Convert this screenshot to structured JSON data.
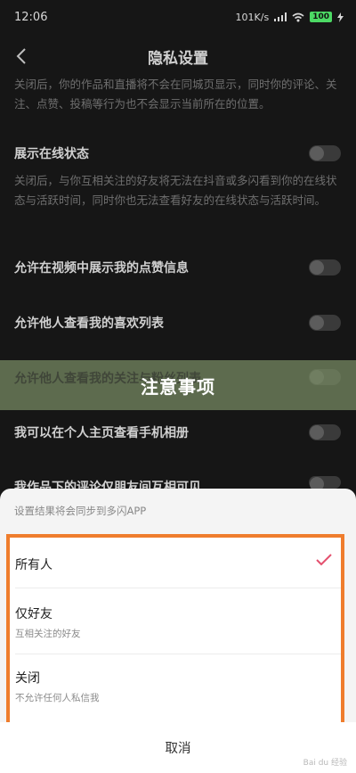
{
  "status_bar": {
    "time": "12:06",
    "network_speed": "101K/s",
    "battery": "100"
  },
  "nav": {
    "title": "隐私设置"
  },
  "top_desc": "关闭后，你的作品和直播将不会在同城页显示，同时你的评论、关注、点赞、投稿等行为也不会显示当前所在的位置。",
  "settings": [
    {
      "title": "展示在线状态",
      "desc": "关闭后，与你互相关注的好友将无法在抖音或多闪看到你的在线状态与活跃时间，同时你也无法查看好友的在线状态与活跃时间。"
    },
    {
      "title": "允许在视频中展示我的点赞信息"
    },
    {
      "title": "允许他人查看我的喜欢列表"
    },
    {
      "title": "允许他人查看我的关注与粉丝列表"
    },
    {
      "title": "我可以在个人主页查看手机相册"
    },
    {
      "title": "我作品下的评论仅朋友间互相可见"
    }
  ],
  "banner": {
    "title": "注意事项",
    "ghost": "允许他人查看我的关注与粉丝列表"
  },
  "sheet": {
    "hint": "设置结果将会同步到多闪APP",
    "options": [
      {
        "label": "所有人",
        "sub": "",
        "selected": true
      },
      {
        "label": "仅好友",
        "sub": "互相关注的好友",
        "selected": false
      },
      {
        "label": "关闭",
        "sub": "不允许任何人私信我",
        "selected": false
      }
    ],
    "cancel": "取消",
    "accent_color": "#ef7d2d",
    "check_color": "#e4506e"
  },
  "watermark": "Bai du 经验"
}
